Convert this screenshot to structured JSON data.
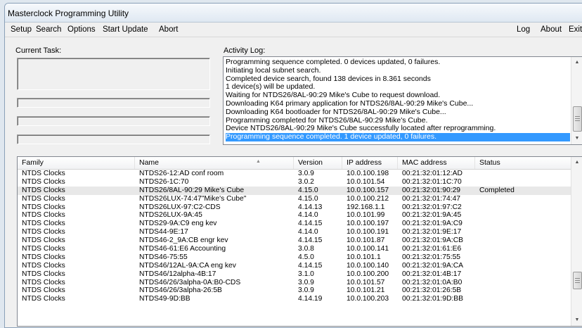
{
  "window": {
    "title": "Masterclock Programming Utility"
  },
  "menu": {
    "left": [
      "Setup",
      "Search",
      "Options",
      "Start Update",
      "Abort"
    ],
    "right": [
      "Log",
      "About",
      "Exit"
    ]
  },
  "current_task": {
    "label": "Current Task:"
  },
  "activity_log": {
    "label": "Activity Log:",
    "lines": [
      "Programming sequence completed.  0 devices updated, 0 failures.",
      "Initiating local subnet search.",
      "Completed device search, found 138 devices in 8.361 seconds",
      "1 device(s) will be updated.",
      "Waiting for NTDS26/8AL-90:29 Mike's Cube to request download.",
      "Downloading K64 primary application for NTDS26/8AL-90:29 Mike's Cube...",
      "Downloading K64 bootloader for NTDS26/8AL-90:29 Mike's Cube...",
      "Programming completed for NTDS26/8AL-90:29 Mike's Cube.",
      "Device NTDS26/8AL-90:29 Mike's Cube successfully located after reprogramming.",
      "Programming sequence completed.  1 device updated, 0 failures."
    ],
    "selected_index": 9
  },
  "table": {
    "columns": [
      "Family",
      "Name",
      "Version",
      "IP address",
      "MAC address",
      "Status"
    ],
    "sorted_column": "Name",
    "selected_row": 2,
    "rows": [
      [
        "NTDS Clocks",
        "NTDS26-12:AD conf room",
        "3.0.9",
        "10.0.100.198",
        "00:21:32:01:12:AD",
        ""
      ],
      [
        "NTDS Clocks",
        "NTDS26-1C:70",
        "3.0.2",
        "10.0.101.54",
        "00:21:32:01:1C:70",
        ""
      ],
      [
        "NTDS Clocks",
        "NTDS26/8AL-90:29 Mike's Cube",
        "4.15.0",
        "10.0.100.157",
        "00:21:32:01:90:29",
        "Completed"
      ],
      [
        "NTDS Clocks",
        "NTDS26LUX-74:47\"Mike's Cube\"",
        "4.15.0",
        "10.0.100.212",
        "00:21:32:01:74:47",
        ""
      ],
      [
        "NTDS Clocks",
        "NTDS26LUX-97:C2-CDS",
        "4.14.13",
        "192.168.1.1",
        "00:21:32:01:97:C2",
        ""
      ],
      [
        "NTDS Clocks",
        "NTDS26LUX-9A:45",
        "4.14.0",
        "10.0.101.99",
        "00:21:32:01:9A:45",
        ""
      ],
      [
        "NTDS Clocks",
        "NTDS29-9A:C9 eng kev",
        "4.14.15",
        "10.0.100.197",
        "00:21:32:01:9A:C9",
        ""
      ],
      [
        "NTDS Clocks",
        "NTDS44-9E:17",
        "4.14.0",
        "10.0.100.191",
        "00:21:32:01:9E:17",
        ""
      ],
      [
        "NTDS Clocks",
        "NTDS46-2_9A:CB engr kev",
        "4.14.15",
        "10.0.101.87",
        "00:21:32:01:9A:CB",
        ""
      ],
      [
        "NTDS Clocks",
        "NTDS46-61:E6 Accounting",
        "3.0.8",
        "10.0.100.141",
        "00:21:32:01:61:E6",
        ""
      ],
      [
        "NTDS Clocks",
        "NTDS46-75:55",
        "4.5.0",
        "10.0.101.1",
        "00:21:32:01:75:55",
        ""
      ],
      [
        "NTDS Clocks",
        "NTDS46/12AL-9A:CA eng kev",
        "4.14.15",
        "10.0.100.140",
        "00:21:32:01:9A:CA",
        ""
      ],
      [
        "NTDS Clocks",
        "NTDS46/12alpha-4B:17",
        "3.1.0",
        "10.0.100.200",
        "00:21:32:01:4B:17",
        ""
      ],
      [
        "NTDS Clocks",
        "NTDS46/26/3alpha-0A:B0-CDS",
        "3.0.9",
        "10.0.101.57",
        "00:21:32:01:0A:B0",
        ""
      ],
      [
        "NTDS Clocks",
        "NTDS46/26/3alpha-26:5B",
        "3.0.9",
        "10.0.101.21",
        "00:21:32:01:26:5B",
        ""
      ],
      [
        "NTDS Clocks",
        "NTDS49-9D:BB",
        "4.14.19",
        "10.0.100.203",
        "00:21:32:01:9D:BB",
        ""
      ]
    ]
  },
  "colors": {
    "selection": "#3399ff",
    "window_bg": "#f0f0f0"
  }
}
